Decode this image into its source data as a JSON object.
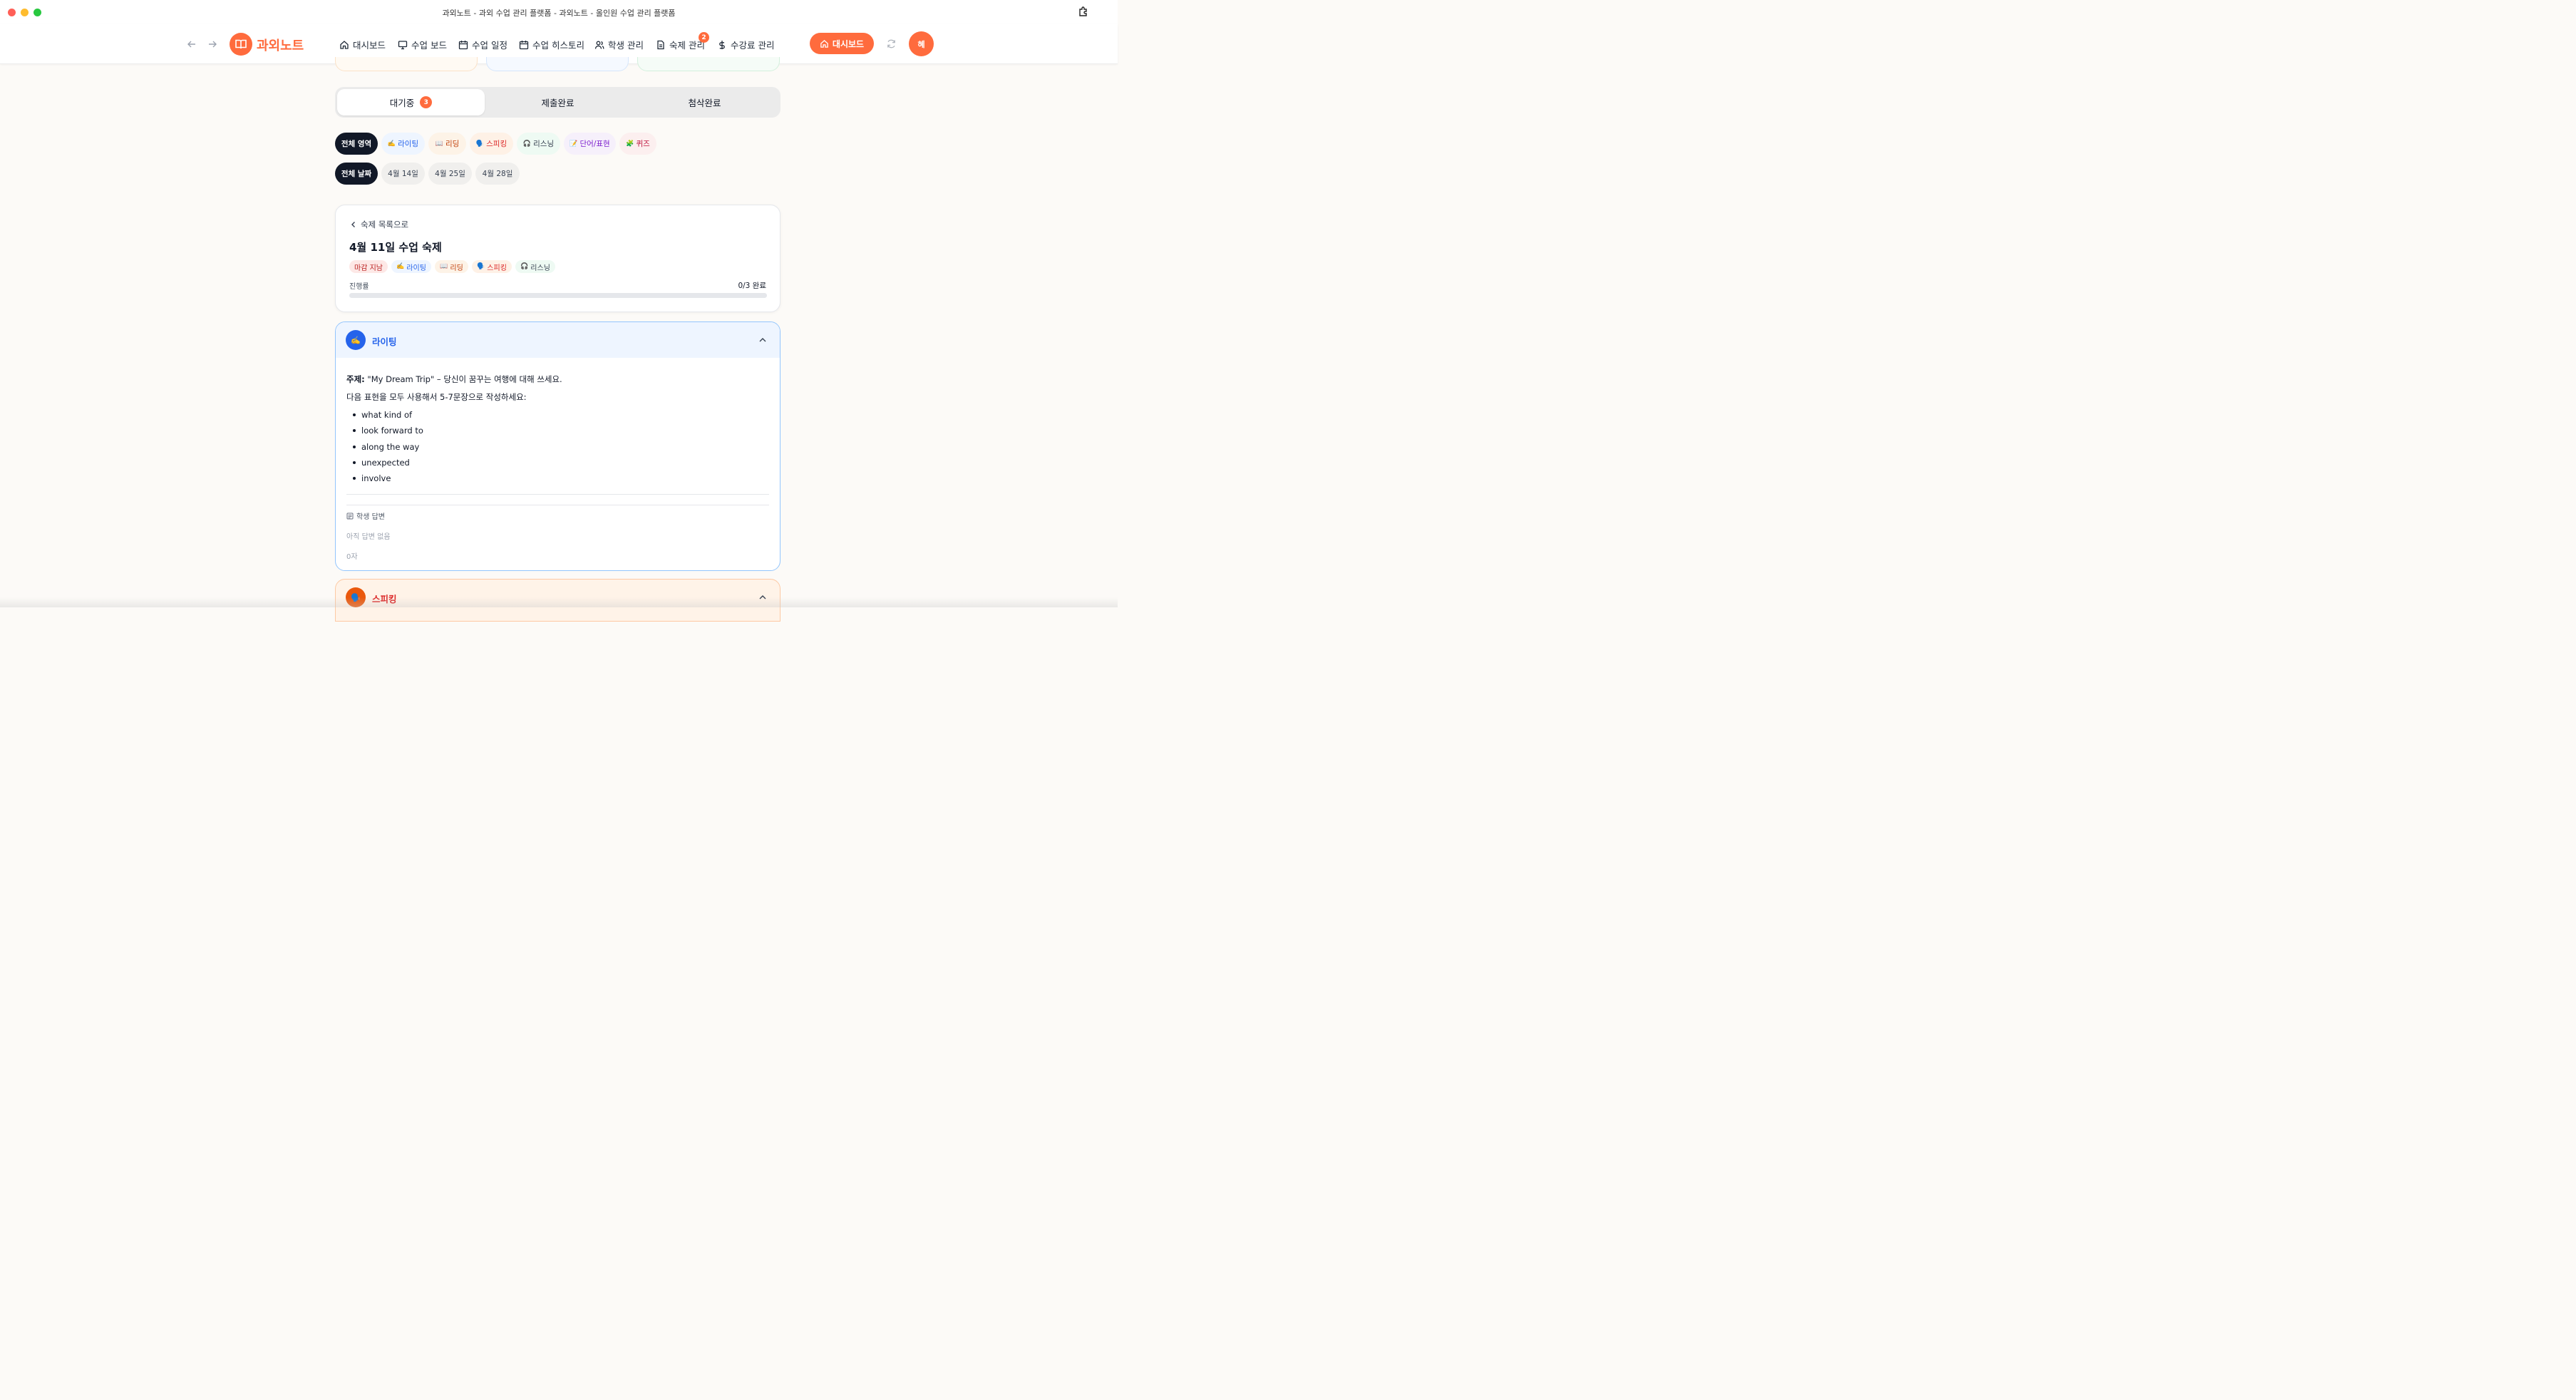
{
  "window": {
    "title": "과외노트 - 과외 수업 관리 플랫폼 - 과외노트 - 올인원 수업 관리 플랫폼"
  },
  "header": {
    "logo_text": "과외노트",
    "nav": [
      {
        "label": "대시보드",
        "icon": "home-icon"
      },
      {
        "label": "수업 보드",
        "icon": "monitor-icon"
      },
      {
        "label": "수업 일정",
        "icon": "calendar-icon"
      },
      {
        "label": "수업 히스토리",
        "icon": "calendar-icon"
      },
      {
        "label": "학생 관리",
        "icon": "users-icon"
      },
      {
        "label": "숙제 관리",
        "icon": "file-icon",
        "badge": "2"
      },
      {
        "label": "수강료 관리",
        "icon": "dollar-icon"
      }
    ],
    "dashboard_button": "대시보드",
    "avatar_initial": "혜",
    "accent": "#ff6b3d"
  },
  "status_tabs": [
    {
      "label": "대기중",
      "count": "3",
      "active": true
    },
    {
      "label": "제출완료",
      "active": false
    },
    {
      "label": "첨삭완료",
      "active": false
    }
  ],
  "area_filters": [
    {
      "label": "전체 영역",
      "emoji": "",
      "active": true
    },
    {
      "label": "라이팅",
      "emoji": "✍️",
      "color": "#2563eb",
      "bg": "#eef5ff"
    },
    {
      "label": "리딩",
      "emoji": "📖",
      "color": "#c2410c",
      "bg": "#fdf3e7"
    },
    {
      "label": "스피킹",
      "emoji": "🗣️",
      "color": "#dc2626",
      "bg": "#fef1e6"
    },
    {
      "label": "리스닝",
      "emoji": "🎧",
      "color": "#374151",
      "bg": "#eefaf3"
    },
    {
      "label": "단어/표현",
      "emoji": "📝",
      "color": "#7e22ce",
      "bg": "#f6f0fb"
    },
    {
      "label": "퀴즈",
      "emoji": "🧩",
      "color": "#be123c",
      "bg": "#fcefef"
    }
  ],
  "date_filters": [
    {
      "label": "전체 날짜",
      "active": true
    },
    {
      "label": "4월 14일"
    },
    {
      "label": "4월 25일"
    },
    {
      "label": "4월 28일"
    }
  ],
  "homework": {
    "back_label": "숙제 목록으로",
    "title": "4월 11일 수업 숙제",
    "tags": [
      {
        "label": "마감 지남",
        "emoji": "",
        "color": "#b91c1c",
        "bg": "#fde8e6"
      },
      {
        "label": "라이팅",
        "emoji": "✍️",
        "color": "#2563eb",
        "bg": "#eef5ff"
      },
      {
        "label": "리딩",
        "emoji": "📖",
        "color": "#c2410c",
        "bg": "#fdf3e7"
      },
      {
        "label": "스피킹",
        "emoji": "🗣️",
        "color": "#dc2626",
        "bg": "#fef1e6"
      },
      {
        "label": "리스닝",
        "emoji": "🎧",
        "color": "#374151",
        "bg": "#eefaf3"
      }
    ],
    "progress_label": "진행률",
    "progress_value": "0/3 완료",
    "progress_fraction": 0
  },
  "writing": {
    "title": "라이팅",
    "icon_emoji": "✍️",
    "topic_label": "주제:",
    "topic_text": " \"My Dream Trip\" – 당신이 꿈꾸는 여행에 대해 쓰세요.",
    "instruction": "다음 표현을 모두 사용해서 5-7문장으로 작성하세요:",
    "expressions": [
      "what kind of",
      "look forward to",
      "along the way",
      "unexpected",
      "involve"
    ],
    "answer_label": "학생 답변",
    "answer_empty": "아직 답변 없음",
    "char_count": "0자"
  },
  "speaking": {
    "title": "스피킹",
    "icon_emoji": "🗣️"
  }
}
